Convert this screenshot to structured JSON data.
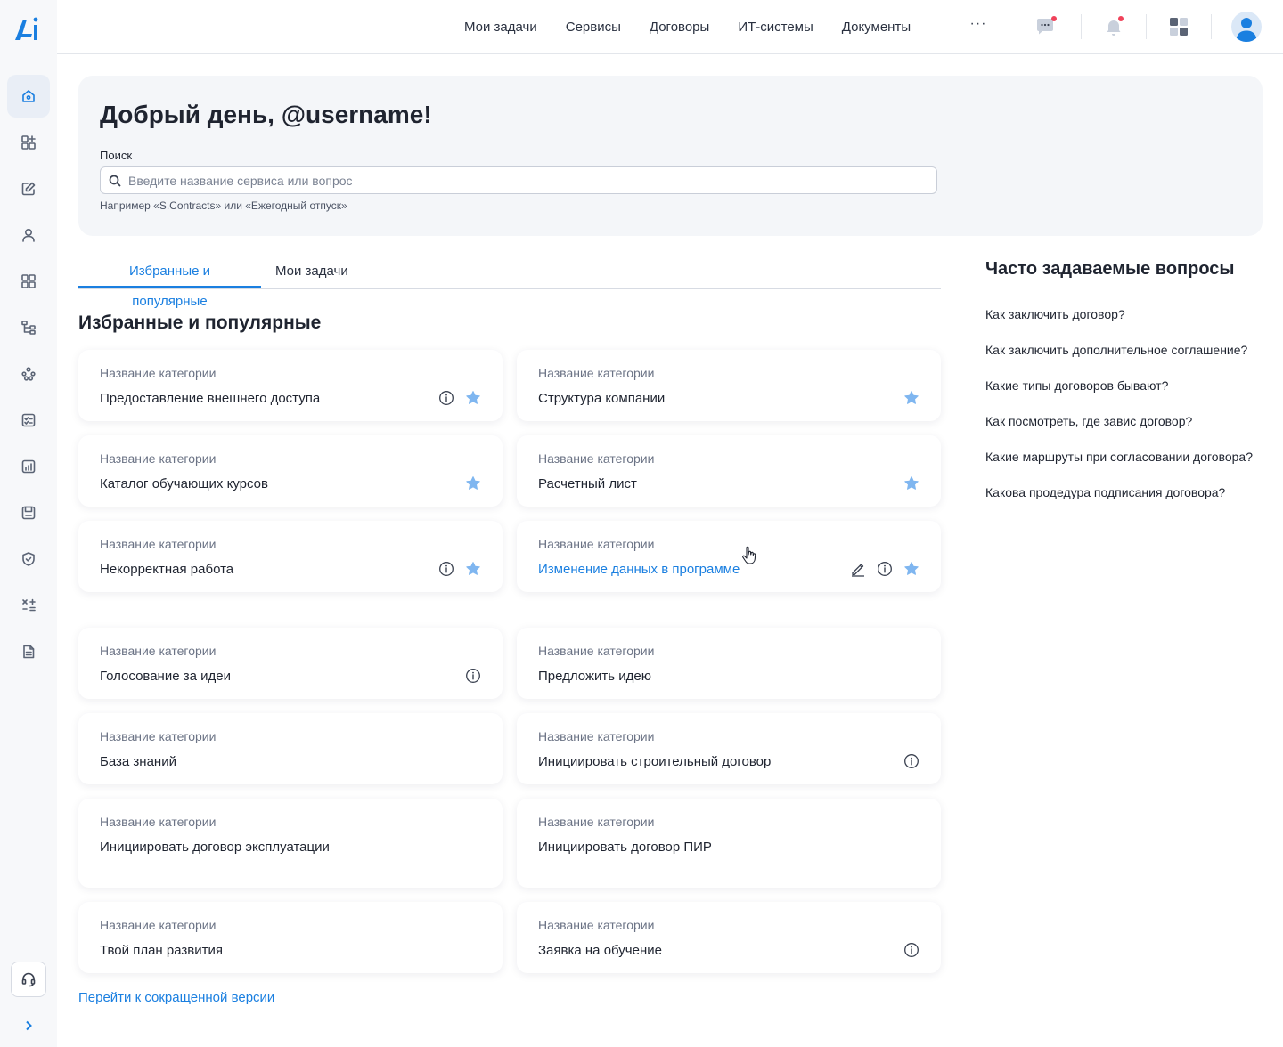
{
  "header": {
    "nav": [
      "Мои задачи",
      "Сервисы",
      "Договоры",
      "ИТ-системы",
      "Документы"
    ],
    "more": "···"
  },
  "sidebar": {
    "items": [
      "home-icon",
      "services-icon",
      "edit-icon",
      "profile-icon",
      "apps-grid-icon",
      "structure-icon",
      "team-icon",
      "tasks-icon",
      "reports-icon",
      "disk-icon",
      "security-icon",
      "calculator-icon",
      "documents-icon"
    ],
    "active": "home-icon"
  },
  "hero": {
    "greeting": "Добрый день, @username!",
    "search_label": "Поиск",
    "search_placeholder": "Введите название сервиса или вопрос",
    "search_value": "",
    "search_hint": "Например «S.Contracts» или «Ежегодный отпуск»"
  },
  "tabs": [
    {
      "label": "Избранные и популярные",
      "active": true
    },
    {
      "label": "Мои задачи",
      "active": false
    }
  ],
  "section_title": "Избранные и популярные",
  "cards": [
    {
      "category": "Название категории",
      "name": "Предоставление внешнего доступа",
      "info": true,
      "star": true
    },
    {
      "category": "Название категории",
      "name": "Структура компании",
      "info": false,
      "star": true
    },
    {
      "category": "Название категории",
      "name": "Каталог обучающих курсов",
      "info": false,
      "star": true
    },
    {
      "category": "Название категории",
      "name": "Расчетный лист",
      "info": false,
      "star": true
    },
    {
      "category": "Название категории",
      "name": "Некорректная работа",
      "info": true,
      "star": true
    },
    {
      "category": "Название категории",
      "name": "Изменение данных в программе",
      "info": true,
      "star": true,
      "edit": true,
      "hover": true
    },
    {
      "category": "Название категории",
      "name": "Голосование за идеи",
      "info": true,
      "star": false
    },
    {
      "category": "Название категории",
      "name": "Предложить идею",
      "info": false,
      "star": false
    },
    {
      "category": "Название категории",
      "name": "База знаний",
      "info": false,
      "star": false
    },
    {
      "category": "Название категории",
      "name": "Инициировать строительный договор",
      "info": true,
      "star": false
    },
    {
      "category": "Название категории",
      "name": "Инициировать договор эксплуатации",
      "info": false,
      "star": false
    },
    {
      "category": "Название категории",
      "name": "Инициировать договор ПИР",
      "info": false,
      "star": false
    },
    {
      "category": "Название категории",
      "name": "Твой план развития",
      "info": false,
      "star": false
    },
    {
      "category": "Название категории",
      "name": "Заявка на обучение",
      "info": true,
      "star": false
    }
  ],
  "faq": {
    "title": "Часто задаваемые вопросы",
    "items": [
      "Как заключить договор?",
      "Как заключить дополнительное соглашение?",
      "Какие типы договоров бывают?",
      "Как посмотреть, где завис договор?",
      "Какие маршруты при согласовании договора?",
      "Какова продедура подписания договора?"
    ]
  },
  "short_version_link": "Перейти к сокращенной версии",
  "colors": {
    "accent": "#1a7fe0",
    "star": "#7fb6f0",
    "notification": "#f0425a"
  }
}
